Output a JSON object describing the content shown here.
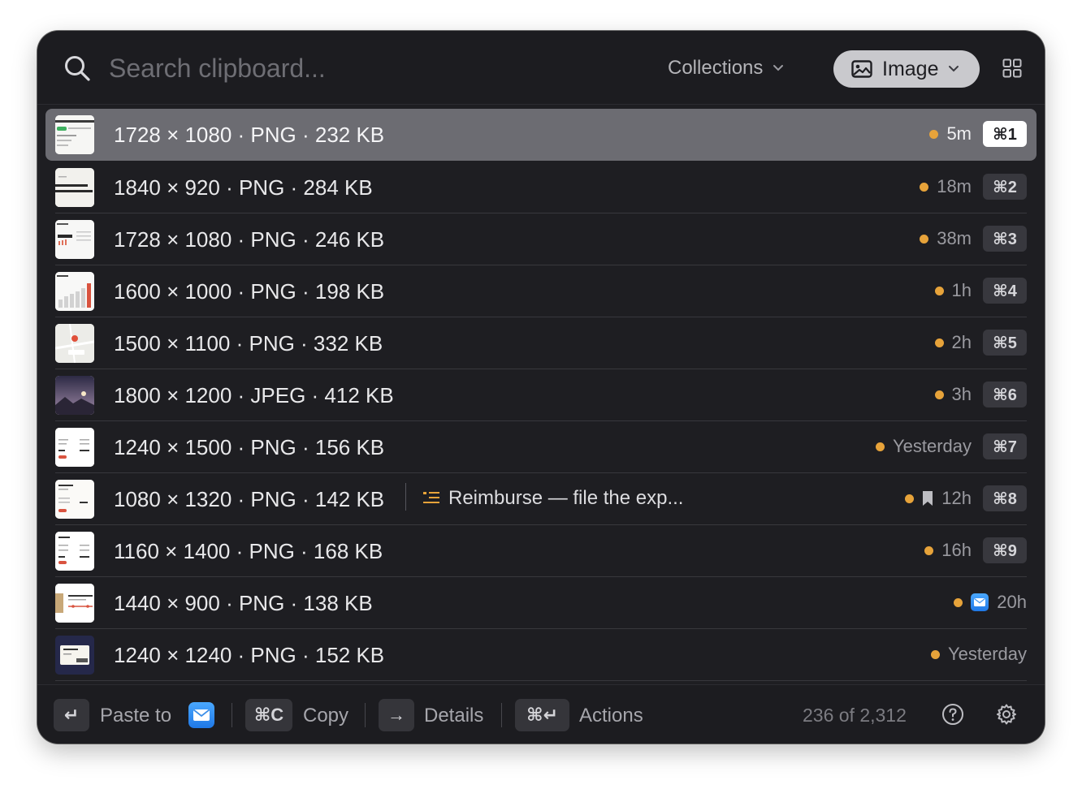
{
  "search": {
    "placeholder": "Search clipboard..."
  },
  "header": {
    "collections_label": "Collections",
    "filter_label": "Image"
  },
  "items": [
    {
      "title": "1728 × 1080 · PNG · 232 KB",
      "time": "5m",
      "shortcut": "⌘1",
      "thumb": "doc-screenshot"
    },
    {
      "title": "1840 × 920 · PNG · 284 KB",
      "time": "18m",
      "shortcut": "⌘2",
      "thumb": "text-screenshot"
    },
    {
      "title": "1728 × 1080 · PNG · 246 KB",
      "time": "38m",
      "shortcut": "⌘3",
      "thumb": "dashboard"
    },
    {
      "title": "1600 × 1000 · PNG · 198 KB",
      "time": "1h",
      "shortcut": "⌘4",
      "thumb": "bar-chart"
    },
    {
      "title": "1500 × 1100 · PNG · 332 KB",
      "time": "2h",
      "shortcut": "⌘5",
      "thumb": "map"
    },
    {
      "title": "1800 × 1200 · JPEG · 412 KB",
      "time": "3h",
      "shortcut": "⌘6",
      "thumb": "landscape"
    },
    {
      "title": "1240 × 1500 · PNG · 156 KB",
      "time": "Yesterday",
      "shortcut": "⌘7",
      "thumb": "receipt"
    },
    {
      "title": "1080 × 1320 · PNG · 142 KB",
      "note": "Reimburse — file the exp...",
      "time": "12h",
      "shortcut": "⌘8",
      "thumb": "invoice"
    },
    {
      "title": "1160 × 1400 · PNG · 168 KB",
      "time": "16h",
      "shortcut": "⌘9",
      "thumb": "invoice-2"
    },
    {
      "title": "1440 × 900 · PNG · 138 KB",
      "time": "20h",
      "shortcut": "",
      "thumb": "shipping"
    },
    {
      "title": "1240 × 1240 · PNG · 152 KB",
      "time": "Yesterday",
      "shortcut": "",
      "thumb": "ticket"
    }
  ],
  "footer": {
    "paste_key": "↵",
    "paste_label": "Paste to",
    "copy_key": "⌘C",
    "copy_label": "Copy",
    "details_key": "→",
    "details_label": "Details",
    "actions_key": "⌘↵",
    "actions_label": "Actions",
    "count": "236 of 2,312"
  },
  "colors": {
    "accent_dot": "#e7a33a",
    "selected_row": "#6c6c72",
    "window_bg": "#1e1e22"
  }
}
